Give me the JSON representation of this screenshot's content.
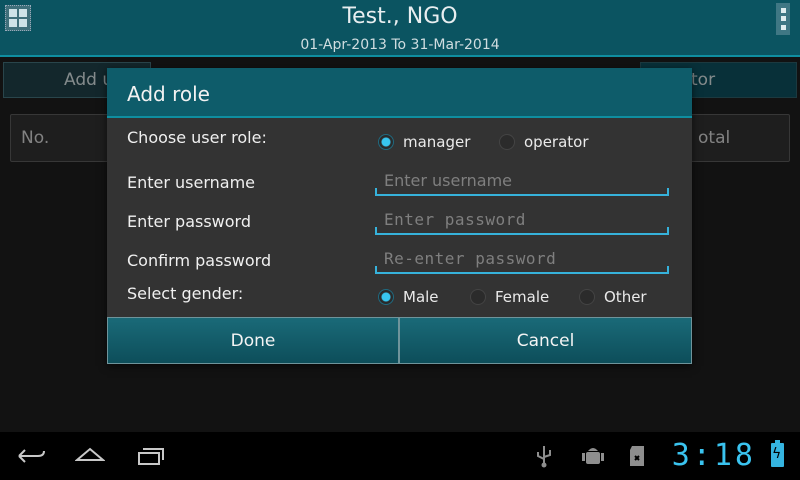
{
  "appbar": {
    "title": "Test., NGO",
    "subtitle": "01-Apr-2013 To 31-Mar-2014",
    "icon": "grid-icon",
    "menu_icon": "overflow-menu-icon"
  },
  "background": {
    "add_button_partial": "Add u",
    "operator_tab_partial": "tor",
    "table_header": {
      "no": "No.",
      "total": "otal"
    }
  },
  "dialog": {
    "title": "Add role",
    "role_label": "Choose user role:",
    "roles": [
      {
        "label": "manager",
        "selected": true
      },
      {
        "label": "operator",
        "selected": false
      }
    ],
    "username_label": "Enter username",
    "username_placeholder": "Enter username",
    "password_label": "Enter password",
    "password_placeholder": "Enter password",
    "confirm_label": "Confirm password",
    "confirm_placeholder": "Re-enter password",
    "gender_label": "Select gender:",
    "genders": [
      {
        "label": "Male",
        "selected": true
      },
      {
        "label": "Female",
        "selected": false
      },
      {
        "label": "Other",
        "selected": false
      }
    ],
    "done_label": "Done",
    "cancel_label": "Cancel"
  },
  "navbar": {
    "icons": [
      "back-icon",
      "home-icon",
      "recent-apps-icon"
    ],
    "status_icons": [
      "usb-icon",
      "android-debug-icon",
      "sd-card-icon"
    ],
    "clock": "3:18",
    "battery": "battery-charging-icon"
  },
  "colors": {
    "accent": "#36b2db",
    "header": "#0e5c6a",
    "appbar": "#0b5461"
  }
}
